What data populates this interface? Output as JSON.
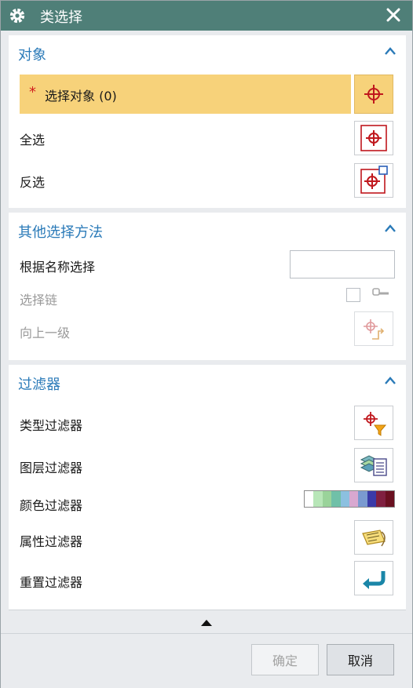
{
  "dialog": {
    "title": "类选择",
    "close_label": "×"
  },
  "sections": {
    "object": {
      "title": "对象",
      "select_required_mark": "*",
      "select_label": "选择对象 (0)",
      "select_all_label": "全选",
      "invert_label": "反选"
    },
    "other": {
      "title": "其他选择方法",
      "by_name_label": "根据名称选择",
      "by_name_value": "",
      "chain_label": "选择链",
      "chain_checked": false,
      "up_one_level_label": "向上一级"
    },
    "filters": {
      "title": "过滤器",
      "type_filter_label": "类型过滤器",
      "layer_filter_label": "图层过滤器",
      "color_filter_label": "颜色过滤器",
      "color_swatches": [
        "#ffffff",
        "#b8e6b8",
        "#9ad39a",
        "#70c0a8",
        "#8cc0e0",
        "#d8a8d0",
        "#7a9ad0",
        "#3a3aa8",
        "#802040",
        "#6a1020"
      ],
      "attribute_filter_label": "属性过滤器",
      "reset_filter_label": "重置过滤器"
    }
  },
  "footer": {
    "ok_label": "确定",
    "cancel_label": "取消"
  },
  "colors": {
    "title_bar": "#4f7f78",
    "section_title": "#2a7ab8",
    "selection_highlight": "#f7d27a",
    "required_star": "#d11f1f"
  }
}
